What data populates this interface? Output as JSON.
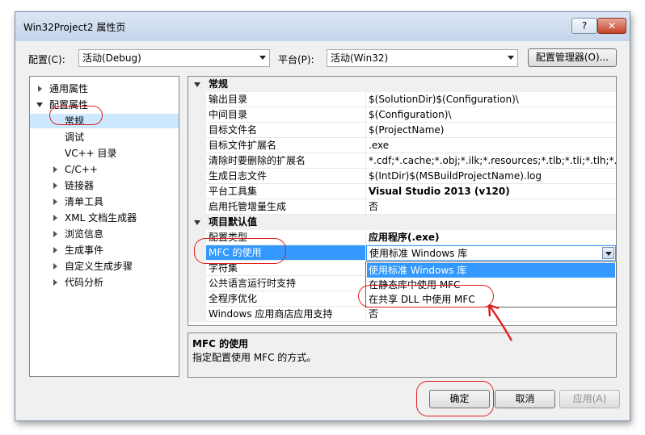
{
  "window": {
    "title": "Win32Project2 属性页",
    "help_label": "?",
    "close_label": "✕"
  },
  "toolbar": {
    "config_label": "配置(C):",
    "config_value": "活动(Debug)",
    "platform_label": "平台(P):",
    "platform_value": "活动(Win32)",
    "config_manager_label": "配置管理器(O)..."
  },
  "tree": {
    "items": [
      {
        "label": "通用属性"
      },
      {
        "label": "配置属性"
      },
      {
        "label": "常规"
      },
      {
        "label": "调试"
      },
      {
        "label": "VC++ 目录"
      },
      {
        "label": "C/C++"
      },
      {
        "label": "链接器"
      },
      {
        "label": "清单工具"
      },
      {
        "label": "XML 文档生成器"
      },
      {
        "label": "浏览信息"
      },
      {
        "label": "生成事件"
      },
      {
        "label": "自定义生成步骤"
      },
      {
        "label": "代码分析"
      }
    ]
  },
  "grid": {
    "cat1": "常规",
    "cat2": "项目默认值",
    "rows": [
      {
        "name": "输出目录",
        "value": "$(SolutionDir)$(Configuration)\\"
      },
      {
        "name": "中间目录",
        "value": "$(Configuration)\\"
      },
      {
        "name": "目标文件名",
        "value": "$(ProjectName)"
      },
      {
        "name": "目标文件扩展名",
        "value": ".exe"
      },
      {
        "name": "清除时要删除的扩展名",
        "value": "*.cdf;*.cache;*.obj;*.ilk;*.resources;*.tlb;*.tli;*.tlh;*.tmp;*"
      },
      {
        "name": "生成日志文件",
        "value": "$(IntDir)$(MSBuildProjectName).log"
      },
      {
        "name": "平台工具集",
        "value": "Visual Studio 2013 (v120)"
      },
      {
        "name": "启用托管增量生成",
        "value": "否"
      },
      {
        "name": "配置类型",
        "value": "应用程序(.exe)"
      },
      {
        "name": "MFC 的使用",
        "value": "使用标准 Windows 库"
      },
      {
        "name": "字符集",
        "value": ""
      },
      {
        "name": "公共语言运行时支持",
        "value": ""
      },
      {
        "name": "全程序优化",
        "value": ""
      },
      {
        "name": "Windows 应用商店应用支持",
        "value": "否"
      }
    ]
  },
  "dropdown": {
    "options": [
      "使用标准 Windows 库",
      "在静态库中使用 MFC",
      "在共享 DLL 中使用 MFC"
    ]
  },
  "description": {
    "title": "MFC 的使用",
    "text": "指定配置使用 MFC 的方式。"
  },
  "buttons": {
    "ok": "确定",
    "cancel": "取消",
    "apply": "应用(A)"
  },
  "colors": {
    "selection": "#3399ff",
    "annotation_red": "#e02020",
    "tree_selected": "#cce8ff"
  }
}
